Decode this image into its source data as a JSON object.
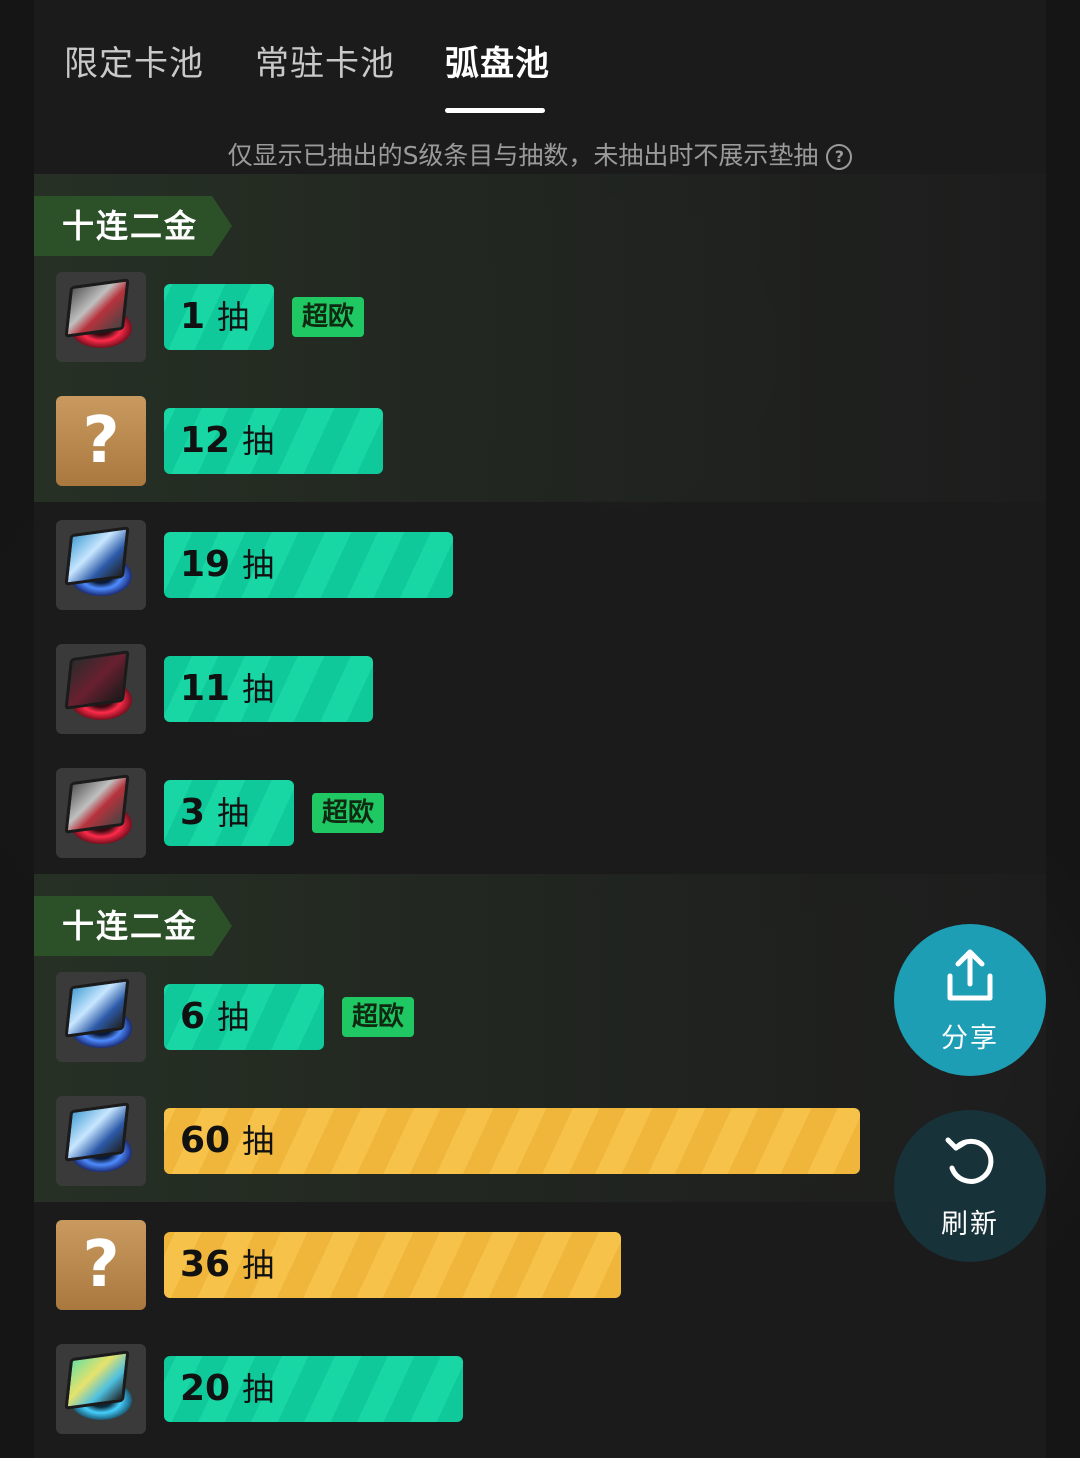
{
  "tabs": [
    {
      "label": "限定卡池",
      "active": false
    },
    {
      "label": "常驻卡池",
      "active": false
    },
    {
      "label": "弧盘池",
      "active": true
    }
  ],
  "notice": "仅显示已抽出的S级条目与抽数，未抽出时不展示垫抽",
  "groups": [
    {
      "tag": "十连二金"
    },
    {
      "tag": "十连二金"
    }
  ],
  "rows": [
    {
      "icon": "red-disc-icon",
      "count": "1",
      "unit": "抽",
      "badge": "超欧",
      "bar_color": "green",
      "fill_pulls": 1
    },
    {
      "icon": "unknown-question-icon",
      "q": "?",
      "count": "12",
      "unit": "抽",
      "badge": "",
      "bar_color": "green",
      "fill_pulls": 12
    },
    {
      "icon": "blue-disc-icon",
      "count": "19",
      "unit": "抽",
      "badge": "",
      "bar_color": "green",
      "fill_pulls": 19
    },
    {
      "icon": "red-disc-icon",
      "count": "11",
      "unit": "抽",
      "badge": "",
      "bar_color": "green",
      "fill_pulls": 11
    },
    {
      "icon": "red-disc-icon",
      "count": "3",
      "unit": "抽",
      "badge": "超欧",
      "bar_color": "green",
      "fill_pulls": 3
    },
    {
      "icon": "blue-disc-icon",
      "count": "6",
      "unit": "抽",
      "badge": "超欧",
      "bar_color": "green",
      "fill_pulls": 6
    },
    {
      "icon": "blue-disc-icon",
      "count": "60",
      "unit": "抽",
      "badge": "",
      "bar_color": "gold",
      "fill_pulls": 60
    },
    {
      "icon": "unknown-question-icon",
      "q": "?",
      "count": "36",
      "unit": "抽",
      "badge": "",
      "bar_color": "gold",
      "fill_pulls": 36
    },
    {
      "icon": "cyan-disc-icon",
      "count": "20",
      "unit": "抽",
      "badge": "",
      "bar_color": "green",
      "fill_pulls": 20
    }
  ],
  "fabs": {
    "share_label": "分享",
    "refresh_label": "刷新"
  },
  "colors": {
    "accent_green": "#12cf9e",
    "accent_gold": "#f0b63b",
    "badge_green": "#20c864",
    "share_blue": "#1e9eb5"
  }
}
